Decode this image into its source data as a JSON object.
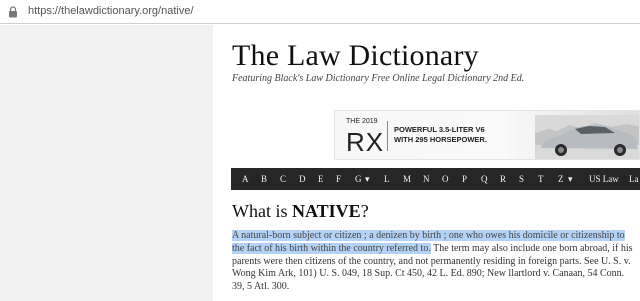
{
  "browser": {
    "url": "https://thelawdictionary.org/native/"
  },
  "site": {
    "title": "The Law Dictionary",
    "tagline": "Featuring Black's Law Dictionary Free Online Legal Dictionary 2nd Ed."
  },
  "ad": {
    "year": "THE 2019",
    "model": "RX",
    "line1": "POWERFUL 3.5-LITER V6",
    "line2": "WITH 295 HORSEPOWER."
  },
  "nav": {
    "letters": [
      "A",
      "B",
      "C",
      "D",
      "E",
      "F",
      "G",
      "L",
      "M",
      "N",
      "O",
      "P",
      "Q",
      "R",
      "S",
      "T",
      "Z"
    ],
    "dropdown_letters": [
      "G",
      "Z"
    ],
    "us_law": "US Law",
    "cut": "La"
  },
  "entry": {
    "heading_prefix": "What is ",
    "term": "NATIVE",
    "heading_suffix": "?",
    "highlighted": "A natural-born subject or citizen ; a denizen by birth ; one who owes his domicile or citizenship to the fact of his birth within the country referred to.",
    "rest": " The term may also include one born abroad, if his parents were then citizens of the country, and not permanently residing in foreign parts. See U. S. v. Wong Kim Ark, 101) U. S. 049, 18 Sup. Ct 450, 42 L. Ed. 890; New llartlord v. Canaan, 54 Conn. 39, 5 Atl. 300."
  },
  "colors": {
    "navbar": "#262626",
    "highlight": "#b3d2f5",
    "gutter": "#f1f1f1"
  }
}
